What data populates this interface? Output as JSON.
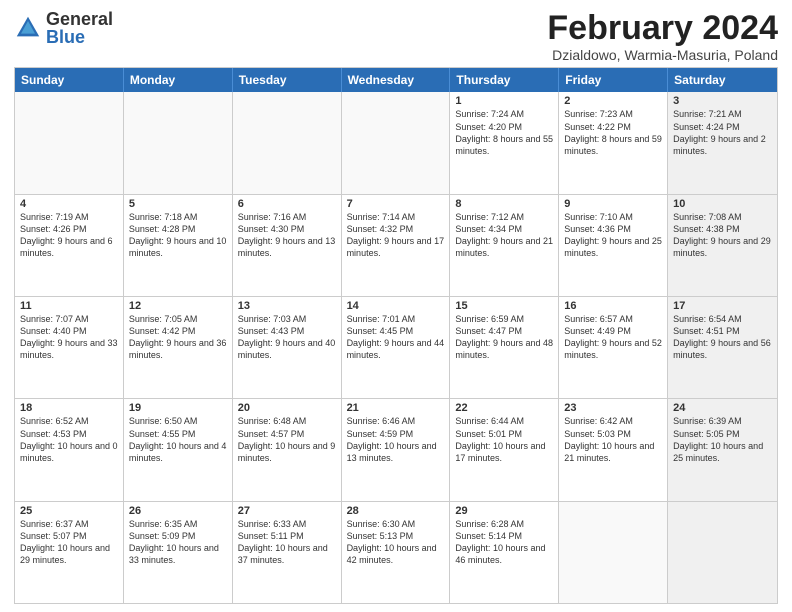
{
  "logo": {
    "general": "General",
    "blue": "Blue"
  },
  "title": "February 2024",
  "location": "Dzialdowo, Warmia-Masuria, Poland",
  "dayHeaders": [
    "Sunday",
    "Monday",
    "Tuesday",
    "Wednesday",
    "Thursday",
    "Friday",
    "Saturday"
  ],
  "weeks": [
    [
      {
        "day": "",
        "info": "",
        "empty": true
      },
      {
        "day": "",
        "info": "",
        "empty": true
      },
      {
        "day": "",
        "info": "",
        "empty": true
      },
      {
        "day": "",
        "info": "",
        "empty": true
      },
      {
        "day": "1",
        "info": "Sunrise: 7:24 AM\nSunset: 4:20 PM\nDaylight: 8 hours\nand 55 minutes.",
        "empty": false
      },
      {
        "day": "2",
        "info": "Sunrise: 7:23 AM\nSunset: 4:22 PM\nDaylight: 8 hours\nand 59 minutes.",
        "empty": false
      },
      {
        "day": "3",
        "info": "Sunrise: 7:21 AM\nSunset: 4:24 PM\nDaylight: 9 hours\nand 2 minutes.",
        "empty": false,
        "shaded": true
      }
    ],
    [
      {
        "day": "4",
        "info": "Sunrise: 7:19 AM\nSunset: 4:26 PM\nDaylight: 9 hours\nand 6 minutes.",
        "empty": false
      },
      {
        "day": "5",
        "info": "Sunrise: 7:18 AM\nSunset: 4:28 PM\nDaylight: 9 hours\nand 10 minutes.",
        "empty": false
      },
      {
        "day": "6",
        "info": "Sunrise: 7:16 AM\nSunset: 4:30 PM\nDaylight: 9 hours\nand 13 minutes.",
        "empty": false
      },
      {
        "day": "7",
        "info": "Sunrise: 7:14 AM\nSunset: 4:32 PM\nDaylight: 9 hours\nand 17 minutes.",
        "empty": false
      },
      {
        "day": "8",
        "info": "Sunrise: 7:12 AM\nSunset: 4:34 PM\nDaylight: 9 hours\nand 21 minutes.",
        "empty": false
      },
      {
        "day": "9",
        "info": "Sunrise: 7:10 AM\nSunset: 4:36 PM\nDaylight: 9 hours\nand 25 minutes.",
        "empty": false
      },
      {
        "day": "10",
        "info": "Sunrise: 7:08 AM\nSunset: 4:38 PM\nDaylight: 9 hours\nand 29 minutes.",
        "empty": false,
        "shaded": true
      }
    ],
    [
      {
        "day": "11",
        "info": "Sunrise: 7:07 AM\nSunset: 4:40 PM\nDaylight: 9 hours\nand 33 minutes.",
        "empty": false
      },
      {
        "day": "12",
        "info": "Sunrise: 7:05 AM\nSunset: 4:42 PM\nDaylight: 9 hours\nand 36 minutes.",
        "empty": false
      },
      {
        "day": "13",
        "info": "Sunrise: 7:03 AM\nSunset: 4:43 PM\nDaylight: 9 hours\nand 40 minutes.",
        "empty": false
      },
      {
        "day": "14",
        "info": "Sunrise: 7:01 AM\nSunset: 4:45 PM\nDaylight: 9 hours\nand 44 minutes.",
        "empty": false
      },
      {
        "day": "15",
        "info": "Sunrise: 6:59 AM\nSunset: 4:47 PM\nDaylight: 9 hours\nand 48 minutes.",
        "empty": false
      },
      {
        "day": "16",
        "info": "Sunrise: 6:57 AM\nSunset: 4:49 PM\nDaylight: 9 hours\nand 52 minutes.",
        "empty": false
      },
      {
        "day": "17",
        "info": "Sunrise: 6:54 AM\nSunset: 4:51 PM\nDaylight: 9 hours\nand 56 minutes.",
        "empty": false,
        "shaded": true
      }
    ],
    [
      {
        "day": "18",
        "info": "Sunrise: 6:52 AM\nSunset: 4:53 PM\nDaylight: 10 hours\nand 0 minutes.",
        "empty": false
      },
      {
        "day": "19",
        "info": "Sunrise: 6:50 AM\nSunset: 4:55 PM\nDaylight: 10 hours\nand 4 minutes.",
        "empty": false
      },
      {
        "day": "20",
        "info": "Sunrise: 6:48 AM\nSunset: 4:57 PM\nDaylight: 10 hours\nand 9 minutes.",
        "empty": false
      },
      {
        "day": "21",
        "info": "Sunrise: 6:46 AM\nSunset: 4:59 PM\nDaylight: 10 hours\nand 13 minutes.",
        "empty": false
      },
      {
        "day": "22",
        "info": "Sunrise: 6:44 AM\nSunset: 5:01 PM\nDaylight: 10 hours\nand 17 minutes.",
        "empty": false
      },
      {
        "day": "23",
        "info": "Sunrise: 6:42 AM\nSunset: 5:03 PM\nDaylight: 10 hours\nand 21 minutes.",
        "empty": false
      },
      {
        "day": "24",
        "info": "Sunrise: 6:39 AM\nSunset: 5:05 PM\nDaylight: 10 hours\nand 25 minutes.",
        "empty": false,
        "shaded": true
      }
    ],
    [
      {
        "day": "25",
        "info": "Sunrise: 6:37 AM\nSunset: 5:07 PM\nDaylight: 10 hours\nand 29 minutes.",
        "empty": false
      },
      {
        "day": "26",
        "info": "Sunrise: 6:35 AM\nSunset: 5:09 PM\nDaylight: 10 hours\nand 33 minutes.",
        "empty": false
      },
      {
        "day": "27",
        "info": "Sunrise: 6:33 AM\nSunset: 5:11 PM\nDaylight: 10 hours\nand 37 minutes.",
        "empty": false
      },
      {
        "day": "28",
        "info": "Sunrise: 6:30 AM\nSunset: 5:13 PM\nDaylight: 10 hours\nand 42 minutes.",
        "empty": false
      },
      {
        "day": "29",
        "info": "Sunrise: 6:28 AM\nSunset: 5:14 PM\nDaylight: 10 hours\nand 46 minutes.",
        "empty": false
      },
      {
        "day": "",
        "info": "",
        "empty": true
      },
      {
        "day": "",
        "info": "",
        "empty": true,
        "shaded": true
      }
    ]
  ]
}
